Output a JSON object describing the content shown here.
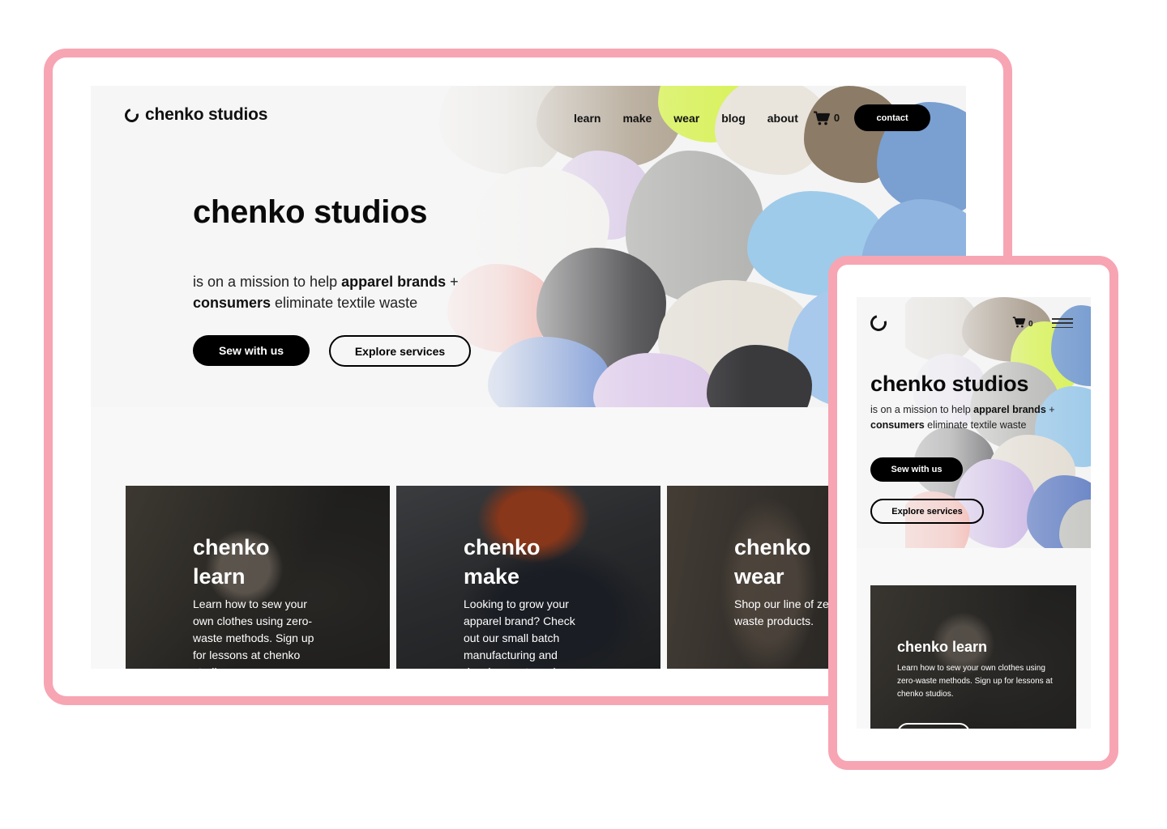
{
  "desktop": {
    "brand": "chenko studios",
    "nav": {
      "links": [
        "learn",
        "make",
        "wear",
        "blog",
        "about"
      ],
      "cart_count": "0",
      "contact_label": "contact"
    },
    "hero": {
      "title": "chenko studios",
      "subtitle_pre": "is on a mission to help ",
      "subtitle_bold1": "apparel brands",
      "subtitle_mid": " + ",
      "subtitle_bold2": "consumers",
      "subtitle_post": " eliminate textile waste",
      "primary_cta": "Sew with us",
      "secondary_cta": "Explore services"
    },
    "cards": [
      {
        "title_1": "chenko",
        "title_2": "learn",
        "body": "Learn how to sew your own clothes using zero-waste methods. Sign up for lessons at chenko studios."
      },
      {
        "title_1": "chenko",
        "title_2": "make",
        "body": "Looking to grow your apparel brand? Check out our small batch manufacturing and development services."
      },
      {
        "title_1": "chenko",
        "title_2": "wear",
        "body": "Shop our line of zero waste products."
      }
    ]
  },
  "mobile": {
    "cart_count": "0",
    "hero": {
      "title": "chenko studios",
      "subtitle_pre": "is on a mission to help ",
      "subtitle_bold1": "apparel brands",
      "subtitle_mid": " + ",
      "subtitle_bold2": "consumers",
      "subtitle_post": " eliminate textile waste",
      "primary_cta": "Sew with us",
      "secondary_cta": "Explore services"
    },
    "card": {
      "title": "chenko learn",
      "body": "Learn how to sew your own clothes using zero-waste methods. Sign up for lessons at chenko studios."
    }
  },
  "colors": {
    "frame_pink": "#f7a5b3",
    "button_black": "#000000",
    "page_background": "#f8f8f8"
  },
  "icons": [
    "logo-ring-icon",
    "cart-icon",
    "hamburger-menu-icon"
  ]
}
